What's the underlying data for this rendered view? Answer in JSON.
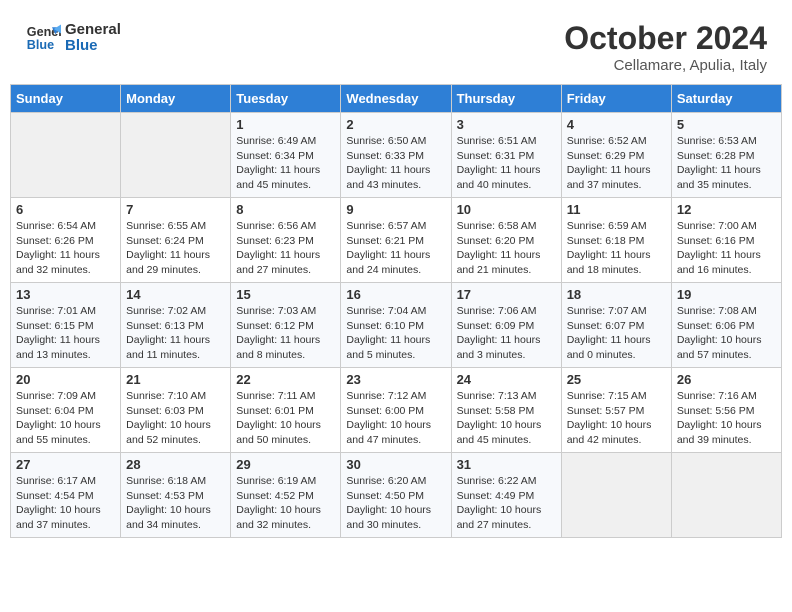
{
  "header": {
    "logo_line1": "General",
    "logo_line2": "Blue",
    "month": "October 2024",
    "location": "Cellamare, Apulia, Italy"
  },
  "days_of_week": [
    "Sunday",
    "Monday",
    "Tuesday",
    "Wednesday",
    "Thursday",
    "Friday",
    "Saturday"
  ],
  "weeks": [
    [
      {
        "day": "",
        "info": ""
      },
      {
        "day": "",
        "info": ""
      },
      {
        "day": "1",
        "info": "Sunrise: 6:49 AM\nSunset: 6:34 PM\nDaylight: 11 hours and 45 minutes."
      },
      {
        "day": "2",
        "info": "Sunrise: 6:50 AM\nSunset: 6:33 PM\nDaylight: 11 hours and 43 minutes."
      },
      {
        "day": "3",
        "info": "Sunrise: 6:51 AM\nSunset: 6:31 PM\nDaylight: 11 hours and 40 minutes."
      },
      {
        "day": "4",
        "info": "Sunrise: 6:52 AM\nSunset: 6:29 PM\nDaylight: 11 hours and 37 minutes."
      },
      {
        "day": "5",
        "info": "Sunrise: 6:53 AM\nSunset: 6:28 PM\nDaylight: 11 hours and 35 minutes."
      }
    ],
    [
      {
        "day": "6",
        "info": "Sunrise: 6:54 AM\nSunset: 6:26 PM\nDaylight: 11 hours and 32 minutes."
      },
      {
        "day": "7",
        "info": "Sunrise: 6:55 AM\nSunset: 6:24 PM\nDaylight: 11 hours and 29 minutes."
      },
      {
        "day": "8",
        "info": "Sunrise: 6:56 AM\nSunset: 6:23 PM\nDaylight: 11 hours and 27 minutes."
      },
      {
        "day": "9",
        "info": "Sunrise: 6:57 AM\nSunset: 6:21 PM\nDaylight: 11 hours and 24 minutes."
      },
      {
        "day": "10",
        "info": "Sunrise: 6:58 AM\nSunset: 6:20 PM\nDaylight: 11 hours and 21 minutes."
      },
      {
        "day": "11",
        "info": "Sunrise: 6:59 AM\nSunset: 6:18 PM\nDaylight: 11 hours and 18 minutes."
      },
      {
        "day": "12",
        "info": "Sunrise: 7:00 AM\nSunset: 6:16 PM\nDaylight: 11 hours and 16 minutes."
      }
    ],
    [
      {
        "day": "13",
        "info": "Sunrise: 7:01 AM\nSunset: 6:15 PM\nDaylight: 11 hours and 13 minutes."
      },
      {
        "day": "14",
        "info": "Sunrise: 7:02 AM\nSunset: 6:13 PM\nDaylight: 11 hours and 11 minutes."
      },
      {
        "day": "15",
        "info": "Sunrise: 7:03 AM\nSunset: 6:12 PM\nDaylight: 11 hours and 8 minutes."
      },
      {
        "day": "16",
        "info": "Sunrise: 7:04 AM\nSunset: 6:10 PM\nDaylight: 11 hours and 5 minutes."
      },
      {
        "day": "17",
        "info": "Sunrise: 7:06 AM\nSunset: 6:09 PM\nDaylight: 11 hours and 3 minutes."
      },
      {
        "day": "18",
        "info": "Sunrise: 7:07 AM\nSunset: 6:07 PM\nDaylight: 11 hours and 0 minutes."
      },
      {
        "day": "19",
        "info": "Sunrise: 7:08 AM\nSunset: 6:06 PM\nDaylight: 10 hours and 57 minutes."
      }
    ],
    [
      {
        "day": "20",
        "info": "Sunrise: 7:09 AM\nSunset: 6:04 PM\nDaylight: 10 hours and 55 minutes."
      },
      {
        "day": "21",
        "info": "Sunrise: 7:10 AM\nSunset: 6:03 PM\nDaylight: 10 hours and 52 minutes."
      },
      {
        "day": "22",
        "info": "Sunrise: 7:11 AM\nSunset: 6:01 PM\nDaylight: 10 hours and 50 minutes."
      },
      {
        "day": "23",
        "info": "Sunrise: 7:12 AM\nSunset: 6:00 PM\nDaylight: 10 hours and 47 minutes."
      },
      {
        "day": "24",
        "info": "Sunrise: 7:13 AM\nSunset: 5:58 PM\nDaylight: 10 hours and 45 minutes."
      },
      {
        "day": "25",
        "info": "Sunrise: 7:15 AM\nSunset: 5:57 PM\nDaylight: 10 hours and 42 minutes."
      },
      {
        "day": "26",
        "info": "Sunrise: 7:16 AM\nSunset: 5:56 PM\nDaylight: 10 hours and 39 minutes."
      }
    ],
    [
      {
        "day": "27",
        "info": "Sunrise: 6:17 AM\nSunset: 4:54 PM\nDaylight: 10 hours and 37 minutes."
      },
      {
        "day": "28",
        "info": "Sunrise: 6:18 AM\nSunset: 4:53 PM\nDaylight: 10 hours and 34 minutes."
      },
      {
        "day": "29",
        "info": "Sunrise: 6:19 AM\nSunset: 4:52 PM\nDaylight: 10 hours and 32 minutes."
      },
      {
        "day": "30",
        "info": "Sunrise: 6:20 AM\nSunset: 4:50 PM\nDaylight: 10 hours and 30 minutes."
      },
      {
        "day": "31",
        "info": "Sunrise: 6:22 AM\nSunset: 4:49 PM\nDaylight: 10 hours and 27 minutes."
      },
      {
        "day": "",
        "info": ""
      },
      {
        "day": "",
        "info": ""
      }
    ]
  ]
}
